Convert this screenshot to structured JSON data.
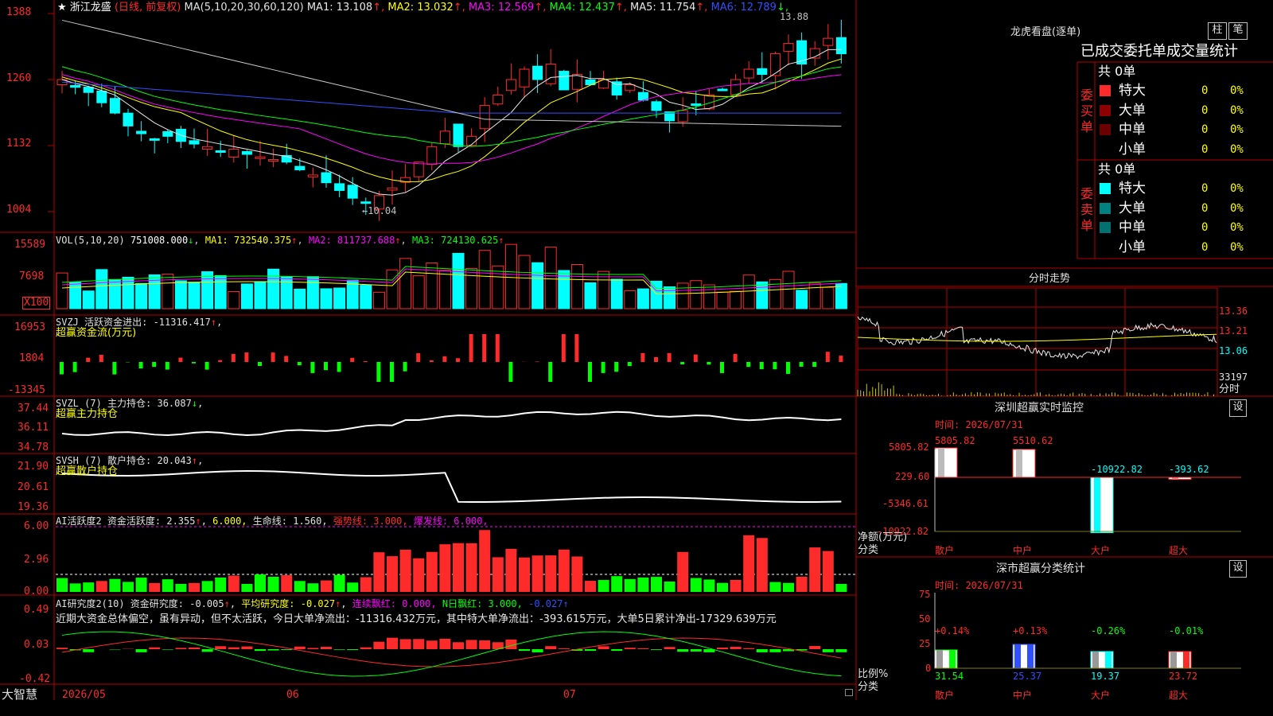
{
  "colors": {
    "red": "#ff2a2a",
    "cyan": "#00ffff",
    "grid": "#b40000",
    "yellow": "#ffff00",
    "magenta": "#ff00ff",
    "green": "#00ff00",
    "white": "#e8e8e8",
    "orange": "#ff8000",
    "darkred": "#800000",
    "teal": "#008080",
    "blue": "#3050ff"
  },
  "main": {
    "star": "★",
    "stock_name": "浙江龙盛",
    "mode": "(日线, 前复权)",
    "ma_label": "MA(5,10,20,30,60,120)",
    "ma": [
      {
        "name": "MA1",
        "value": "13.108",
        "arrow": "↑"
      },
      {
        "name": "MA2",
        "value": "13.032",
        "arrow": "↑"
      },
      {
        "name": "MA3",
        "value": "12.569",
        "arrow": "↑"
      },
      {
        "name": "MA4",
        "value": "12.437",
        "arrow": "↑"
      },
      {
        "name": "MA5",
        "value": "11.754",
        "arrow": "↑"
      },
      {
        "name": "MA6",
        "value": "12.789",
        "arrow": "↓"
      }
    ],
    "yticks": [
      "1388",
      "1260",
      "1132",
      "1004"
    ],
    "high_label": "13.88",
    "low_label": "←10.04"
  },
  "vol": {
    "label": "VOL(5,10,20)",
    "value": "751008.000",
    "arrow": "↓",
    "ma1": "MA1: 732540.375",
    "ma2": "MA2: 811737.688",
    "ma3": "MA3: 724130.625",
    "yticks": [
      "15589",
      "7698"
    ],
    "unit": "X100"
  },
  "svzj": {
    "label": "SVZJ  活跃资金进出: -11316.417",
    "sub": "超赢资金流(万元)",
    "yticks": [
      "16953",
      "1804",
      "-13345"
    ]
  },
  "svzl": {
    "label": "SVZL (7) 主力持仓: 36.087",
    "sub": "超赢主力持仓",
    "yticks": [
      "37.44",
      "36.11",
      "34.78"
    ]
  },
  "svsh": {
    "label": "SVSH (7) 散户持仓: 20.043",
    "sub": "超赢散户持仓",
    "yticks": [
      "21.90",
      "20.61",
      "19.36"
    ]
  },
  "ai1": {
    "label": "AI活跃度2 资金活跃度: 2.355",
    "v2": "6.000,",
    "life": "生命线: 1.560,",
    "strong": "强势线: 3.000,",
    "burst": "爆发线: 6.000,",
    "yticks": [
      "6.00",
      "2.96",
      "0.00"
    ]
  },
  "ai2": {
    "label": "AI研究度2(10) 资金研究度: -0.005",
    "avg": "平均研究度: -0.027",
    "lian": "连续飘红: 0.000,",
    "nday": "N日飘红: 3.000,",
    "last": "-0.027",
    "summary": "近期大资金总体偏空，虽有异动，但不太活跃，今日大单净流出：-11316.432万元，其中特大单净流出：-393.615万元，大单5日累计净出-17329.639万元",
    "yticks": [
      "0.49",
      "0.03",
      "-0.42"
    ]
  },
  "bottom": {
    "brand": "大智慧",
    "dates": [
      "2026/05",
      "06",
      "07"
    ]
  },
  "dragon": {
    "title": "龙虎看盘(逐单)",
    "btn_bar": "柱",
    "btn_pen": "笔",
    "subtitle": "已成交委托单成交量统计",
    "buy_label": "委买单",
    "sell_label": "委卖单",
    "buy_total": "共 0单",
    "sell_total": "共 0单",
    "rows_buy": [
      {
        "label": "特大",
        "n": "0",
        "p": "0%"
      },
      {
        "label": "大单",
        "n": "0",
        "p": "0%"
      },
      {
        "label": "中单",
        "n": "0",
        "p": "0%"
      },
      {
        "label": "小单",
        "n": "0",
        "p": "0%"
      }
    ],
    "rows_sell": [
      {
        "label": "特大",
        "n": "0",
        "p": "0%"
      },
      {
        "label": "大单",
        "n": "0",
        "p": "0%"
      },
      {
        "label": "中单",
        "n": "0",
        "p": "0%"
      },
      {
        "label": "小单",
        "n": "0",
        "p": "0%"
      }
    ]
  },
  "intraday": {
    "title": "分时走势",
    "yticks": [
      "13.36",
      "13.21",
      "13.06"
    ],
    "vol": "33197",
    "unit": "分时"
  },
  "sz_monitor": {
    "title": "深圳超赢实时监控",
    "btn": "设",
    "time": "时间: 2026/07/31",
    "yticks": [
      "5805.82",
      "229.60",
      "-5346.61",
      "-10922.82"
    ],
    "ylabel": "净额(万元)",
    "xlabel": "分类",
    "cats": [
      "散户",
      "中户",
      "大户",
      "超大"
    ],
    "values": [
      5805.82,
      5510.62,
      -10922.82,
      -393.62
    ],
    "value_labels": [
      "5805.82",
      "5510.62",
      "-10922.82",
      "-393.62"
    ]
  },
  "sz_class": {
    "title": "深市超赢分类统计",
    "btn": "设",
    "time": "时间: 2026/07/31",
    "yticks": [
      "75",
      "50",
      "25",
      "0"
    ],
    "ylabel": "比例%",
    "xlabel": "分类",
    "cats": [
      "散户",
      "中户",
      "大户",
      "超大"
    ],
    "values": [
      31.54,
      25.37,
      19.37,
      23.72
    ],
    "changes": [
      "+0.14%",
      "+0.13%",
      "-0.26%",
      "-0.01%"
    ]
  }
}
